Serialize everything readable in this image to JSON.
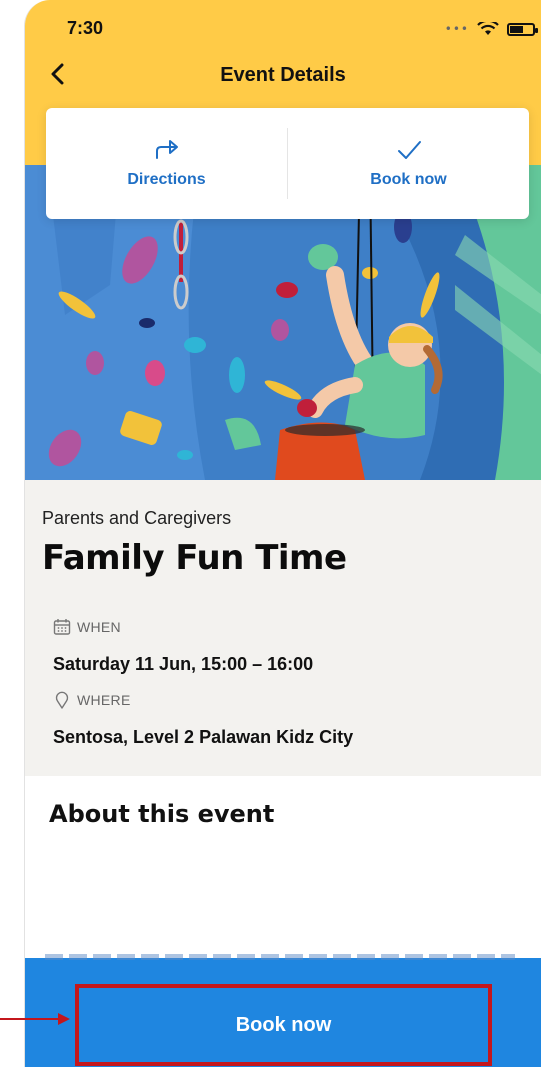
{
  "status_bar": {
    "time": "7:30",
    "signal": "•••"
  },
  "header": {
    "title": "Event Details"
  },
  "actions": {
    "directions_label": "Directions",
    "book_label": "Book now"
  },
  "event": {
    "category": "Parents and Caregivers",
    "title": "Family Fun Time",
    "when_label": "WHEN",
    "when_value": "Saturday 11 Jun, 15:00 – 16:00",
    "where_label": "WHERE",
    "where_value": "Sentosa, Level 2 Palawan Kidz City"
  },
  "about": {
    "title": "About this event"
  },
  "footer": {
    "book_label": "Book now"
  },
  "colors": {
    "header": "#ffcb47",
    "accent": "#1f6fc5",
    "primary_button": "#1f86e0",
    "highlight": "#c4161c"
  },
  "icons": [
    "back-chevron-icon",
    "directions-icon",
    "checkmark-icon",
    "calendar-icon",
    "location-pin-icon"
  ]
}
